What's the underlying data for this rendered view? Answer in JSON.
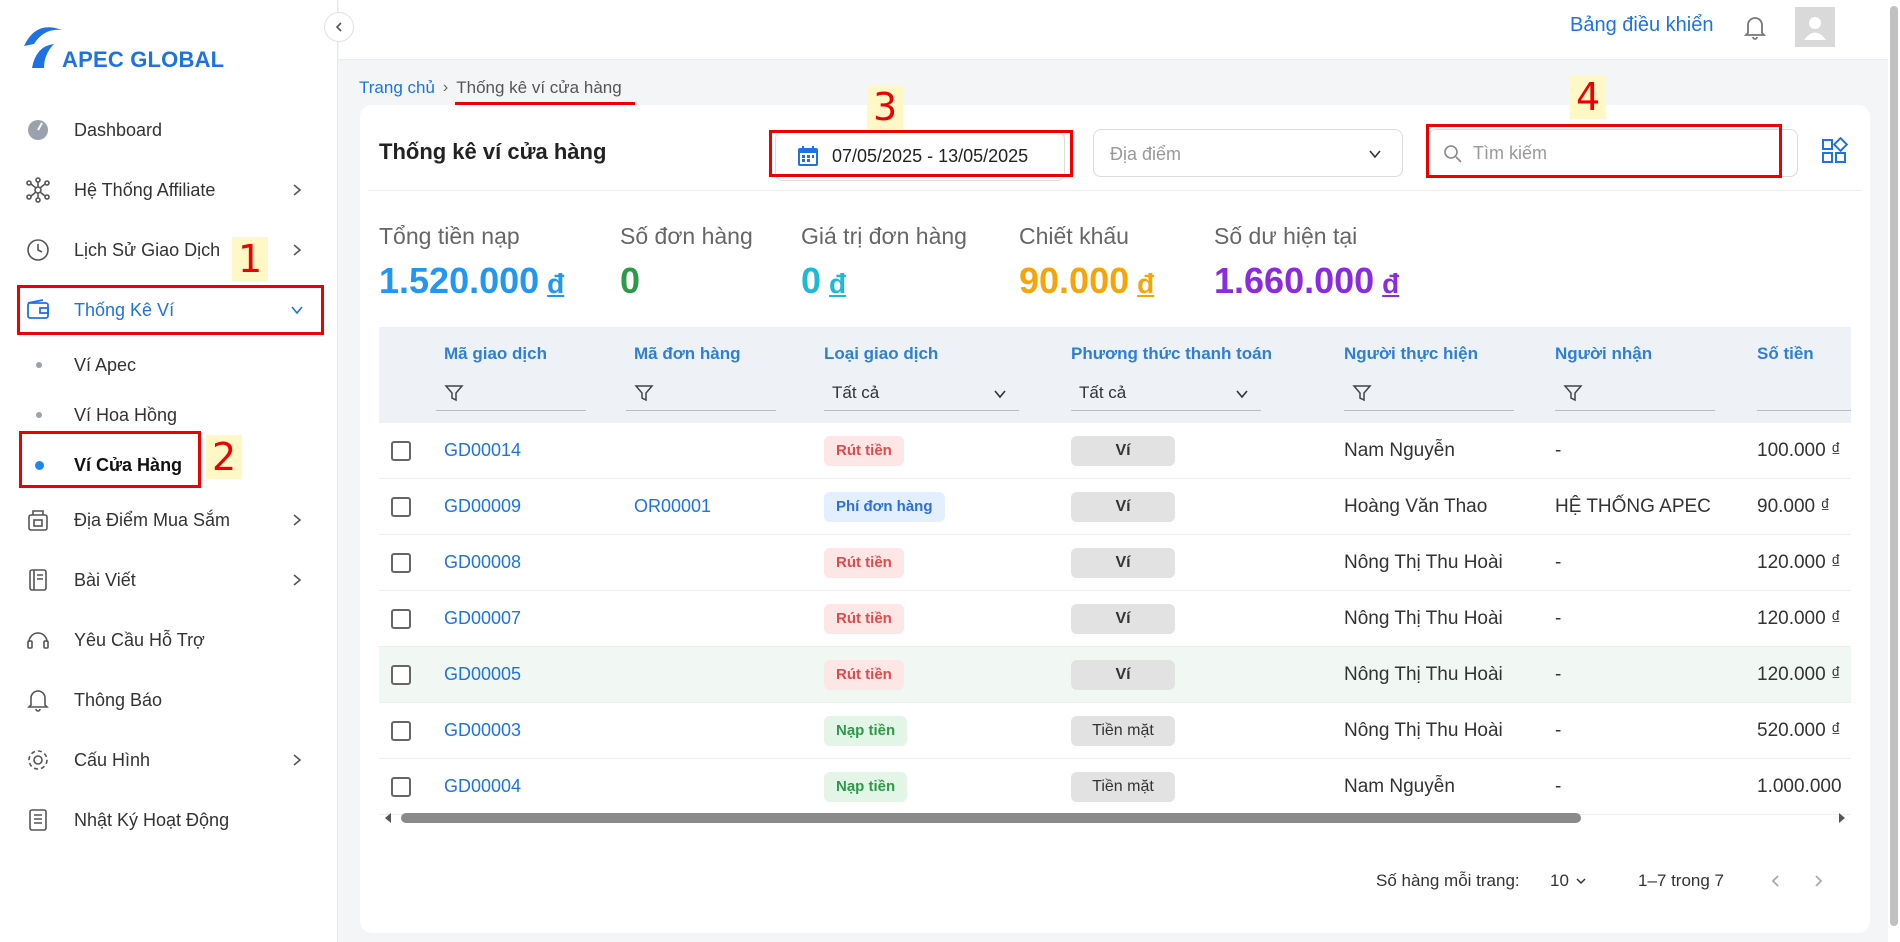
{
  "brand": {
    "name": "APEC GLOBAL"
  },
  "topbar": {
    "dashboard_link": "Bảng điều khiển"
  },
  "sidebar": {
    "items": [
      {
        "label": "Dashboard"
      },
      {
        "label": "Hệ Thống Affiliate"
      },
      {
        "label": "Lịch Sử Giao Dịch"
      },
      {
        "label": "Thống Kê Ví"
      },
      {
        "label": "Địa Điểm Mua Sắm"
      },
      {
        "label": "Bài Viết"
      },
      {
        "label": "Yêu Cầu Hỗ Trợ"
      },
      {
        "label": "Thông Báo"
      },
      {
        "label": "Cấu Hình"
      },
      {
        "label": "Nhật Ký Hoạt Động"
      }
    ],
    "subitems": [
      {
        "label": "Ví Apec"
      },
      {
        "label": "Ví Hoa Hồng"
      },
      {
        "label": "Ví Cửa Hàng"
      }
    ]
  },
  "annotations": [
    "1",
    "2",
    "3",
    "4"
  ],
  "breadcrumb": {
    "home": "Trang chủ",
    "current": "Thống kê ví cửa hàng"
  },
  "card": {
    "title": "Thống kê ví cửa hàng",
    "date_range": "07/05/2025 - 13/05/2025",
    "location_placeholder": "Địa điểm",
    "search_placeholder": "Tìm kiếm"
  },
  "stats": [
    {
      "label": "Tổng tiền nạp",
      "value": "1.520.000",
      "currency": "đ",
      "color": "#2196f3"
    },
    {
      "label": "Số đơn hàng",
      "value": "0",
      "currency": "",
      "color": "#2e9a48"
    },
    {
      "label": "Giá trị đơn hàng",
      "value": "0",
      "currency": "đ",
      "color": "#1eb8d8"
    },
    {
      "label": "Chiết khấu",
      "value": "90.000",
      "currency": "đ",
      "color": "#f5a50b"
    },
    {
      "label": "Số dư hiện tại",
      "value": "1.660.000",
      "currency": "đ",
      "color": "#8a2be2"
    }
  ],
  "table": {
    "columns": [
      "Mã giao dịch",
      "Mã đơn hàng",
      "Loại giao dịch",
      "Phương thức thanh toán",
      "Người thực hiện",
      "Người nhận",
      "Số tiền"
    ],
    "filter_all": "Tất cả",
    "rows": [
      {
        "id": "GD00014",
        "order": "",
        "type": "Rút tiền",
        "method": "Ví",
        "actor": "Nam Nguyễn",
        "receiver": "-",
        "amount": "100.000 ₫"
      },
      {
        "id": "GD00009",
        "order": "OR00001",
        "type": "Phí đơn hàng",
        "method": "Ví",
        "actor": "Hoàng Văn Thao",
        "receiver": "HỆ THỐNG APEC",
        "amount": "90.000 ₫"
      },
      {
        "id": "GD00008",
        "order": "",
        "type": "Rút tiền",
        "method": "Ví",
        "actor": "Nông Thị Thu Hoài",
        "receiver": "-",
        "amount": "120.000 ₫"
      },
      {
        "id": "GD00007",
        "order": "",
        "type": "Rút tiền",
        "method": "Ví",
        "actor": "Nông Thị Thu Hoài",
        "receiver": "-",
        "amount": "120.000 ₫"
      },
      {
        "id": "GD00005",
        "order": "",
        "type": "Rút tiền",
        "method": "Ví",
        "actor": "Nông Thị Thu Hoài",
        "receiver": "-",
        "amount": "120.000 ₫"
      },
      {
        "id": "GD00003",
        "order": "",
        "type": "Nạp tiền",
        "method": "Tiền mặt",
        "actor": "Nông Thị Thu Hoài",
        "receiver": "-",
        "amount": "520.000 ₫"
      },
      {
        "id": "GD00004",
        "order": "",
        "type": "Nạp tiền",
        "method": "Tiền mặt",
        "actor": "Nam Nguyễn",
        "receiver": "-",
        "amount": "1.000.000"
      }
    ]
  },
  "pagination": {
    "rows_per_page_label": "Số hàng mỗi trang:",
    "rows_per_page": "10",
    "range": "1–7 trong 7"
  }
}
